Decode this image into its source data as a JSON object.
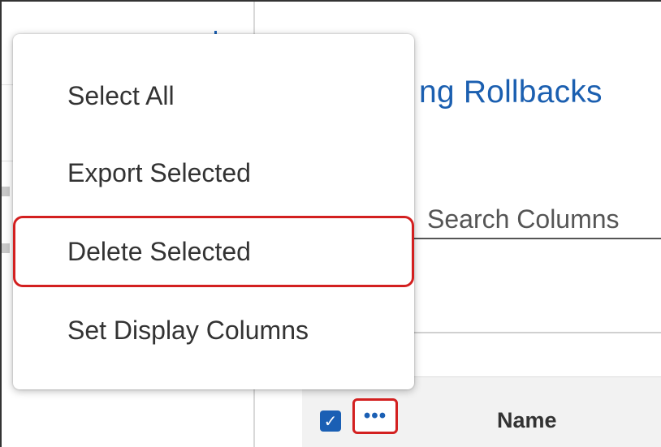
{
  "page": {
    "title": "ng Rollbacks"
  },
  "search": {
    "placeholder": "Search Columns"
  },
  "menu": {
    "items": [
      {
        "label": "Select All"
      },
      {
        "label": "Export Selected"
      },
      {
        "label": "Delete Selected",
        "highlighted": true
      },
      {
        "label": "Set Display Columns"
      }
    ]
  },
  "table": {
    "header": {
      "checkbox_checked": true,
      "more_icon": "more-horizontal-icon",
      "more_glyph": "•••",
      "columns": [
        "Name"
      ]
    }
  },
  "colors": {
    "accent": "#1a5fb4",
    "highlight_border": "#d32020"
  }
}
